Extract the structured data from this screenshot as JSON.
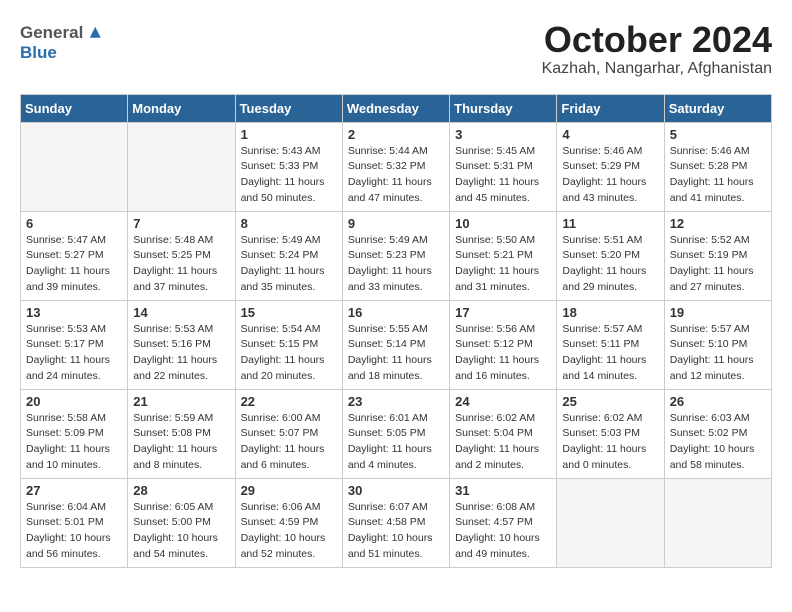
{
  "header": {
    "logo_general": "General",
    "logo_blue": "Blue",
    "month": "October 2024",
    "location": "Kazhah, Nangarhar, Afghanistan"
  },
  "weekdays": [
    "Sunday",
    "Monday",
    "Tuesday",
    "Wednesday",
    "Thursday",
    "Friday",
    "Saturday"
  ],
  "weeks": [
    [
      {
        "day": "",
        "info": ""
      },
      {
        "day": "",
        "info": ""
      },
      {
        "day": "1",
        "info": "Sunrise: 5:43 AM\nSunset: 5:33 PM\nDaylight: 11 hours\nand 50 minutes."
      },
      {
        "day": "2",
        "info": "Sunrise: 5:44 AM\nSunset: 5:32 PM\nDaylight: 11 hours\nand 47 minutes."
      },
      {
        "day": "3",
        "info": "Sunrise: 5:45 AM\nSunset: 5:31 PM\nDaylight: 11 hours\nand 45 minutes."
      },
      {
        "day": "4",
        "info": "Sunrise: 5:46 AM\nSunset: 5:29 PM\nDaylight: 11 hours\nand 43 minutes."
      },
      {
        "day": "5",
        "info": "Sunrise: 5:46 AM\nSunset: 5:28 PM\nDaylight: 11 hours\nand 41 minutes."
      }
    ],
    [
      {
        "day": "6",
        "info": "Sunrise: 5:47 AM\nSunset: 5:27 PM\nDaylight: 11 hours\nand 39 minutes."
      },
      {
        "day": "7",
        "info": "Sunrise: 5:48 AM\nSunset: 5:25 PM\nDaylight: 11 hours\nand 37 minutes."
      },
      {
        "day": "8",
        "info": "Sunrise: 5:49 AM\nSunset: 5:24 PM\nDaylight: 11 hours\nand 35 minutes."
      },
      {
        "day": "9",
        "info": "Sunrise: 5:49 AM\nSunset: 5:23 PM\nDaylight: 11 hours\nand 33 minutes."
      },
      {
        "day": "10",
        "info": "Sunrise: 5:50 AM\nSunset: 5:21 PM\nDaylight: 11 hours\nand 31 minutes."
      },
      {
        "day": "11",
        "info": "Sunrise: 5:51 AM\nSunset: 5:20 PM\nDaylight: 11 hours\nand 29 minutes."
      },
      {
        "day": "12",
        "info": "Sunrise: 5:52 AM\nSunset: 5:19 PM\nDaylight: 11 hours\nand 27 minutes."
      }
    ],
    [
      {
        "day": "13",
        "info": "Sunrise: 5:53 AM\nSunset: 5:17 PM\nDaylight: 11 hours\nand 24 minutes."
      },
      {
        "day": "14",
        "info": "Sunrise: 5:53 AM\nSunset: 5:16 PM\nDaylight: 11 hours\nand 22 minutes."
      },
      {
        "day": "15",
        "info": "Sunrise: 5:54 AM\nSunset: 5:15 PM\nDaylight: 11 hours\nand 20 minutes."
      },
      {
        "day": "16",
        "info": "Sunrise: 5:55 AM\nSunset: 5:14 PM\nDaylight: 11 hours\nand 18 minutes."
      },
      {
        "day": "17",
        "info": "Sunrise: 5:56 AM\nSunset: 5:12 PM\nDaylight: 11 hours\nand 16 minutes."
      },
      {
        "day": "18",
        "info": "Sunrise: 5:57 AM\nSunset: 5:11 PM\nDaylight: 11 hours\nand 14 minutes."
      },
      {
        "day": "19",
        "info": "Sunrise: 5:57 AM\nSunset: 5:10 PM\nDaylight: 11 hours\nand 12 minutes."
      }
    ],
    [
      {
        "day": "20",
        "info": "Sunrise: 5:58 AM\nSunset: 5:09 PM\nDaylight: 11 hours\nand 10 minutes."
      },
      {
        "day": "21",
        "info": "Sunrise: 5:59 AM\nSunset: 5:08 PM\nDaylight: 11 hours\nand 8 minutes."
      },
      {
        "day": "22",
        "info": "Sunrise: 6:00 AM\nSunset: 5:07 PM\nDaylight: 11 hours\nand 6 minutes."
      },
      {
        "day": "23",
        "info": "Sunrise: 6:01 AM\nSunset: 5:05 PM\nDaylight: 11 hours\nand 4 minutes."
      },
      {
        "day": "24",
        "info": "Sunrise: 6:02 AM\nSunset: 5:04 PM\nDaylight: 11 hours\nand 2 minutes."
      },
      {
        "day": "25",
        "info": "Sunrise: 6:02 AM\nSunset: 5:03 PM\nDaylight: 11 hours\nand 0 minutes."
      },
      {
        "day": "26",
        "info": "Sunrise: 6:03 AM\nSunset: 5:02 PM\nDaylight: 10 hours\nand 58 minutes."
      }
    ],
    [
      {
        "day": "27",
        "info": "Sunrise: 6:04 AM\nSunset: 5:01 PM\nDaylight: 10 hours\nand 56 minutes."
      },
      {
        "day": "28",
        "info": "Sunrise: 6:05 AM\nSunset: 5:00 PM\nDaylight: 10 hours\nand 54 minutes."
      },
      {
        "day": "29",
        "info": "Sunrise: 6:06 AM\nSunset: 4:59 PM\nDaylight: 10 hours\nand 52 minutes."
      },
      {
        "day": "30",
        "info": "Sunrise: 6:07 AM\nSunset: 4:58 PM\nDaylight: 10 hours\nand 51 minutes."
      },
      {
        "day": "31",
        "info": "Sunrise: 6:08 AM\nSunset: 4:57 PM\nDaylight: 10 hours\nand 49 minutes."
      },
      {
        "day": "",
        "info": ""
      },
      {
        "day": "",
        "info": ""
      }
    ]
  ]
}
